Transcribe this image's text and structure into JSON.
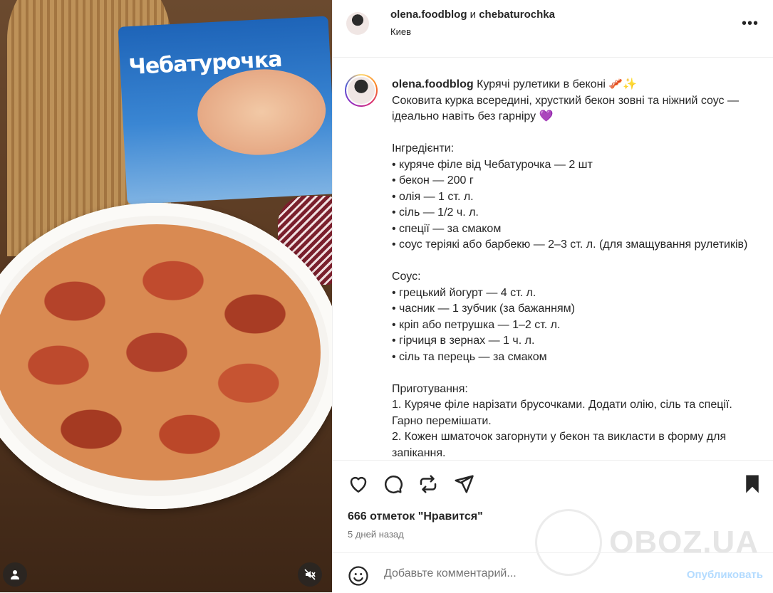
{
  "post": {
    "header": {
      "author": "olena.foodblog",
      "conjunction": "и",
      "coauthor": "chebaturochka",
      "location": "Киев",
      "more_icon": "more-horizontal-icon"
    },
    "caption": {
      "username": "olena.foodblog",
      "text": " Курячі рулетики в беконі 🥓✨\nСоковита курка всередині, хрусткий бекон зовні та ніжний соус — ідеально навіть без гарніру 💜\n\nІнгредієнти:\n• куряче філе від Чебатурочка — 2 шт\n• бекон — 200 г\n• олія — 1 ст. л.\n• сіль — 1/2 ч. л.\n• спеції — за смаком\n• соус теріякі або барбекю — 2–3 ст. л. (для змащування рулетиків)\n\nСоус:\n• грецький йогурт — 4 ст. л.\n• часник — 1 зубчик (за бажанням)\n• кріп або петрушка — 1–2 ст. л.\n• гірчиця в зернах — 1 ч. л.\n• сіль та перець — за смаком\n\nПриготування:\n1. Куряче філе нарізати брусочками. Додати олію, сіль та спеції. Гарно перемішати.\n2. Кожен шматочок загорнути у бекон та викласти в форму для запікання."
    },
    "media": {
      "package_brand": "Чебатурочка",
      "user_icon": "user-icon",
      "mute_icon": "volume-muted-icon"
    },
    "actions": {
      "like_icon": "heart-icon",
      "comment_icon": "comment-icon",
      "share_icon": "repost-icon",
      "send_icon": "send-icon",
      "save_icon": "bookmark-icon"
    },
    "likes": "666 отметок \"Нравится\"",
    "time": "5 дней назад",
    "watermark": "OBOZ.UA",
    "comment": {
      "placeholder": "Добавьте комментарий...",
      "publish_label": "Опубликовать",
      "emoji_icon": "emoji-icon"
    }
  }
}
